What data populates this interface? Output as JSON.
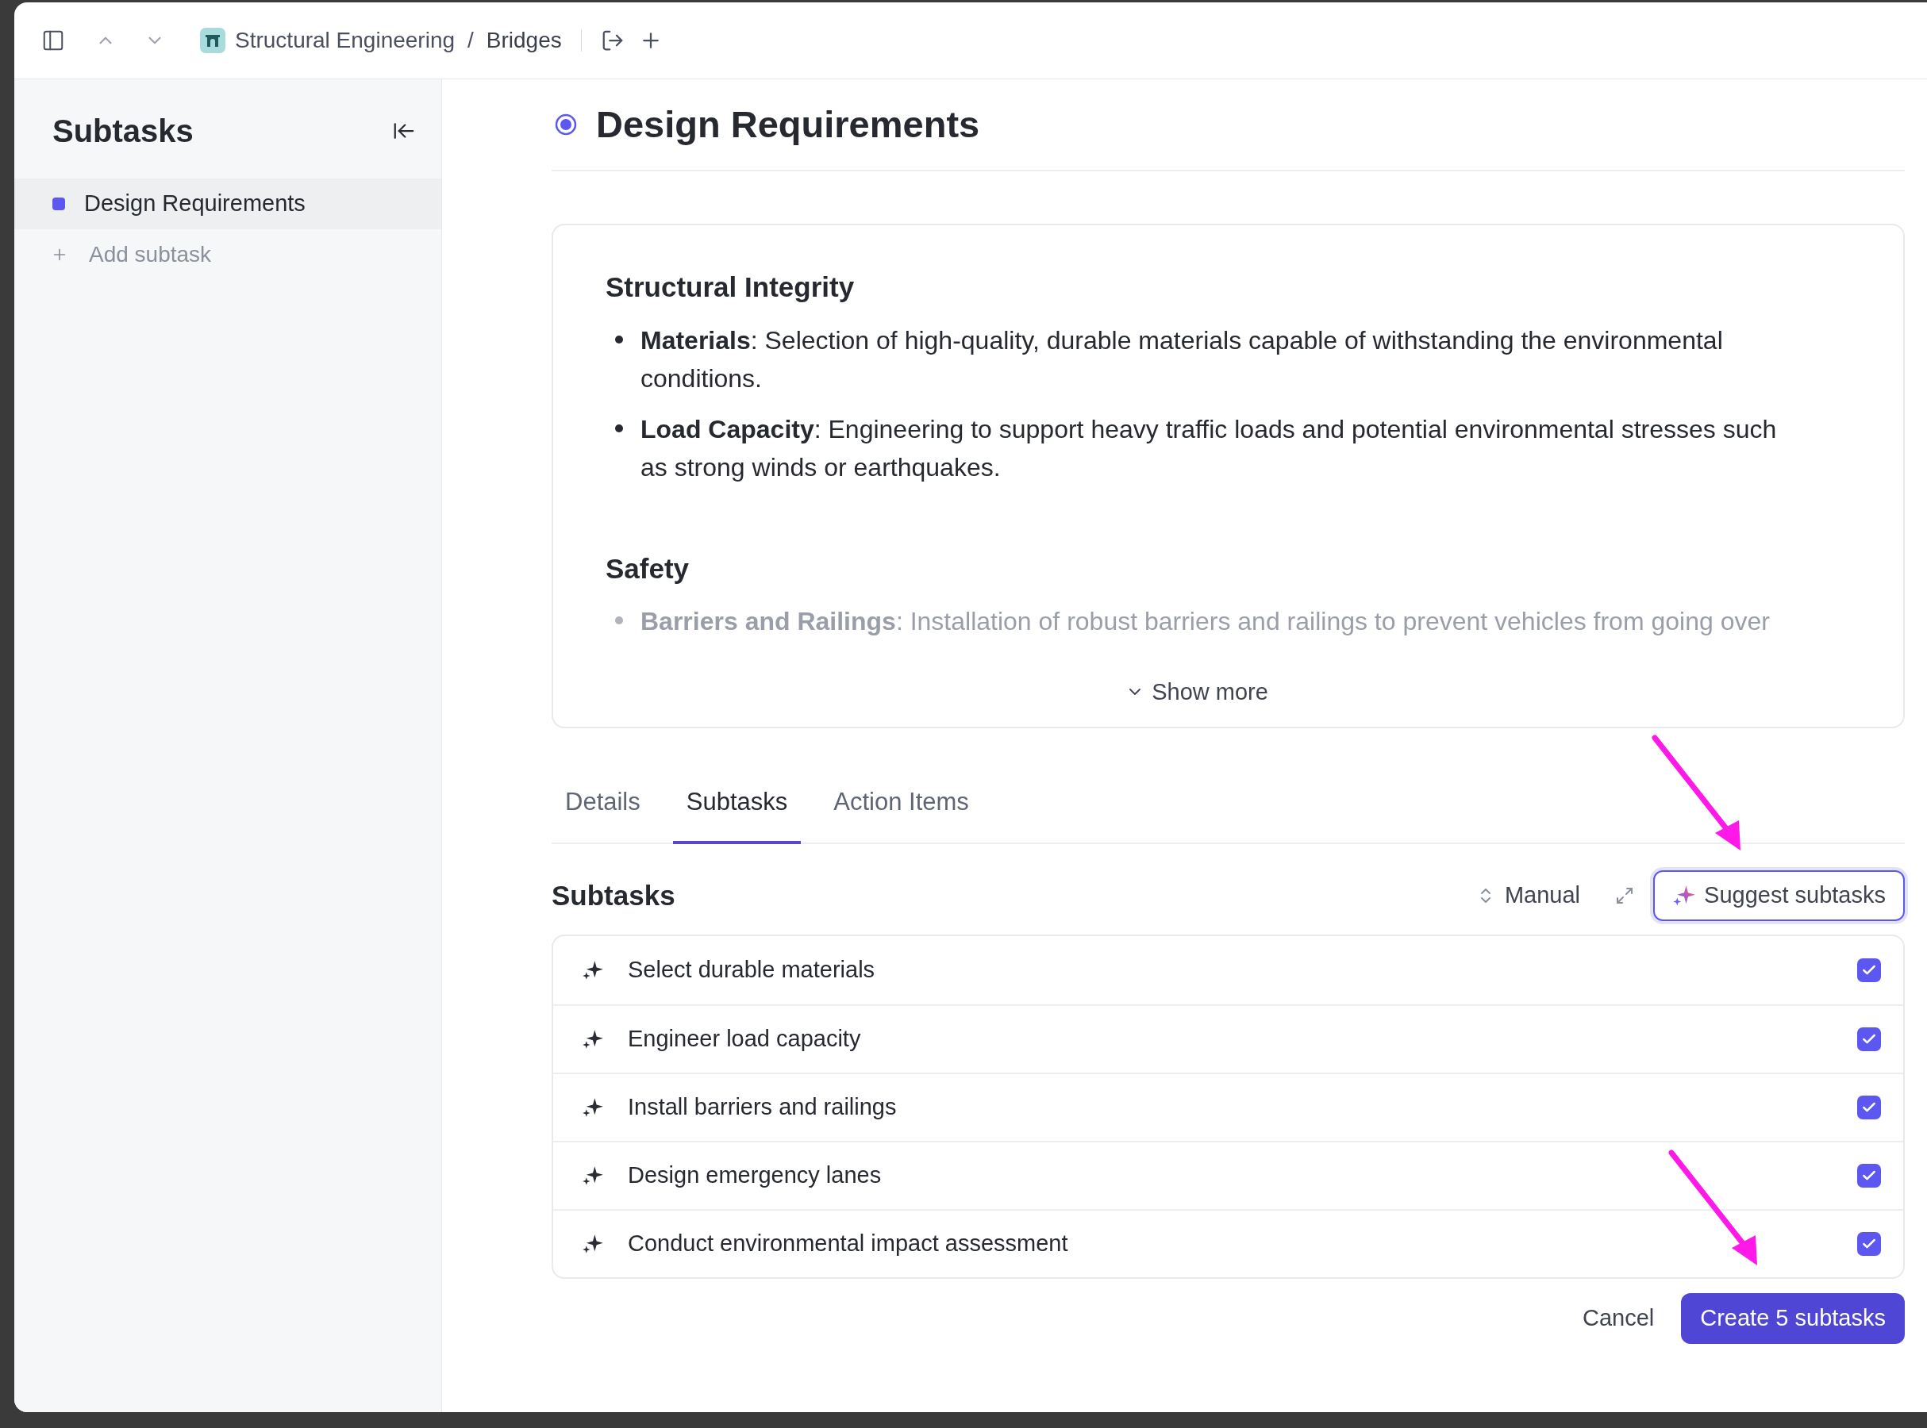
{
  "topbar": {
    "breadcrumb": [
      {
        "label": "Structural Engineering"
      },
      {
        "label": "Bridges"
      }
    ],
    "separator": "/"
  },
  "sidebar": {
    "title": "Subtasks",
    "items": [
      {
        "label": "Design Requirements",
        "selected": true,
        "color": "#5b57f0"
      }
    ],
    "add_label": "Add subtask"
  },
  "task": {
    "title": "Design Requirements"
  },
  "description": {
    "sections": [
      {
        "heading": "Structural Integrity",
        "faded": false,
        "bullets": [
          "**Materials**: Selection of high-quality, durable materials capable of withstanding the environmental conditions.",
          "**Load Capacity**: Engineering to support heavy traffic loads and potential environmental stresses such as strong winds or earthquakes."
        ]
      },
      {
        "heading": "Safety",
        "faded": true,
        "bullets": [
          "**Barriers and Railings**: Installation of robust barriers and railings to prevent vehicles from going over"
        ]
      }
    ],
    "show_more": "Show more"
  },
  "tabs": [
    {
      "label": "Details",
      "selected": false
    },
    {
      "label": "Subtasks",
      "selected": true
    },
    {
      "label": "Action Items",
      "selected": false
    }
  ],
  "subtasks": {
    "title": "Subtasks",
    "sort": "Manual",
    "suggest": "Suggest subtasks",
    "items": [
      {
        "label": "Select durable materials",
        "checked": true
      },
      {
        "label": "Engineer load capacity",
        "checked": true
      },
      {
        "label": "Install barriers and railings",
        "checked": true
      },
      {
        "label": "Design emergency lanes",
        "checked": true
      },
      {
        "label": "Conduct environmental impact assessment",
        "checked": true
      }
    ],
    "cancel": "Cancel",
    "create": "Create 5 subtasks"
  }
}
